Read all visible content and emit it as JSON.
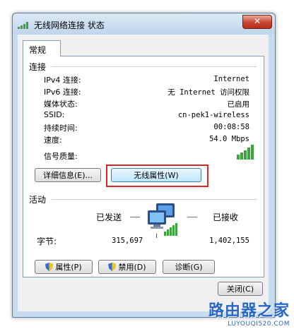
{
  "window": {
    "title": "无线网络连接 状态",
    "close_glyph": "✕"
  },
  "tabs": [
    {
      "label": "常规"
    }
  ],
  "connection": {
    "header": "连接",
    "rows": [
      {
        "label": "IPv4 连接:",
        "value": "Internet"
      },
      {
        "label": "IPv6 连接:",
        "value": "无 Internet 访问权限"
      },
      {
        "label": "媒体状态:",
        "value": "已启用"
      },
      {
        "label": "SSID:",
        "value": "cn-pek1-wireless"
      },
      {
        "label": "持续时间:",
        "value": "00:08:58"
      },
      {
        "label": "速度:",
        "value": "54.0 Mbps"
      }
    ],
    "signal_label": "信号质量:",
    "signal_bars": 5,
    "details_button": "详细信息(E)...",
    "wireless_props_button": "无线属性(W)"
  },
  "activity": {
    "header": "活动",
    "sent_label": "已发送",
    "received_label": "已接收",
    "bytes_label": "字节:",
    "bytes_sent": "315,697",
    "bytes_received": "1,402,155"
  },
  "actions": {
    "properties": "属性(P)",
    "disable": "禁用(D)",
    "diagnose": "诊断(G)",
    "close": "关闭(C)"
  },
  "watermark": {
    "title": "路由器之家",
    "url": "LUYOUQI520.COM"
  },
  "colors": {
    "signal": "#3aa53a",
    "highlight": "#d62828",
    "watermark": "#2a66c7"
  }
}
